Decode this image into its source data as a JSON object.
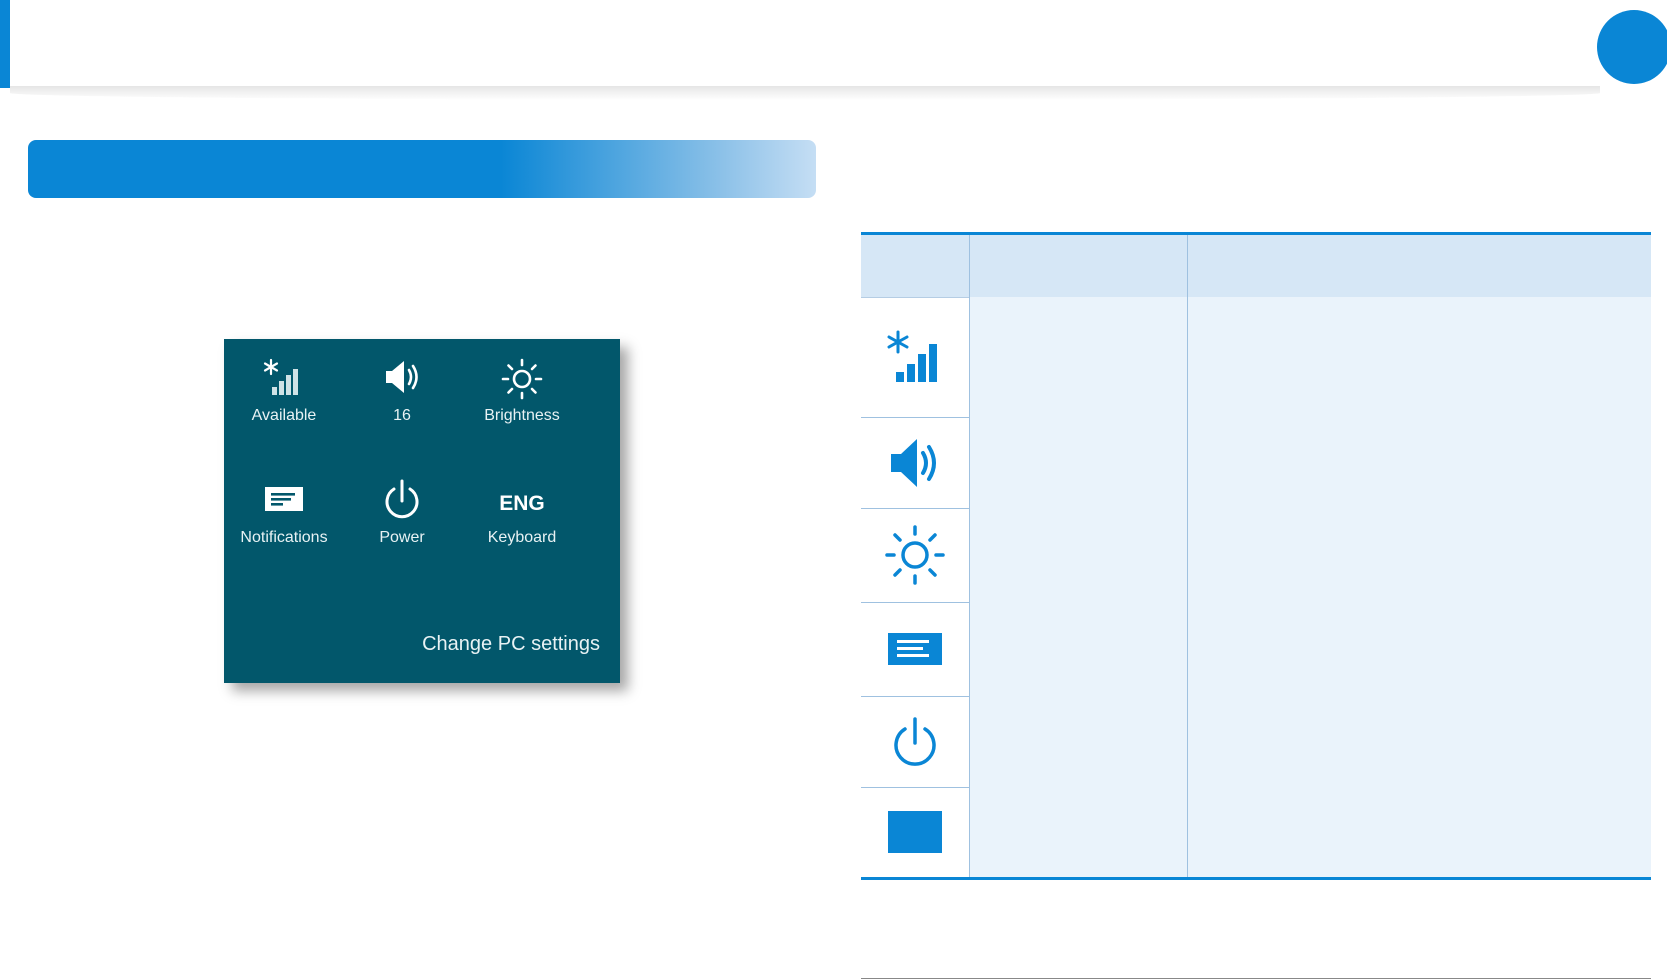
{
  "colors": {
    "accent": "#0a86d5",
    "panel_bg": "#02576b",
    "table_header_bg": "#d6e7f6",
    "table_cell_bg": "#eaf3fb"
  },
  "settings_panel": {
    "tiles": [
      {
        "label": "Available",
        "icon": "network-signal-icon"
      },
      {
        "label": "16",
        "icon": "volume-icon"
      },
      {
        "label": "Brightness",
        "icon": "brightness-icon"
      },
      {
        "label": "Notifications",
        "icon": "notifications-icon"
      },
      {
        "label": "Power",
        "icon": "power-icon"
      },
      {
        "label": "Keyboard",
        "icon": "keyboard-icon",
        "icon_text": "ENG"
      }
    ],
    "change_pc_settings": "Change PC settings"
  },
  "table": {
    "rows": [
      {
        "icon": "network-signal-icon"
      },
      {
        "icon": "volume-icon"
      },
      {
        "icon": "brightness-icon"
      },
      {
        "icon": "notifications-icon"
      },
      {
        "icon": "power-icon"
      },
      {
        "icon": "keyboard-icon"
      }
    ]
  }
}
